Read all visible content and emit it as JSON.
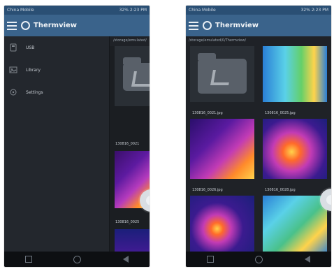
{
  "left": {
    "status": {
      "carrier": "China Mobile",
      "right": "32% 2:23 PM"
    },
    "app_title": "Thermview",
    "path": "/storage/emulated/",
    "menu": [
      {
        "label": "USB",
        "icon": "usb-icon"
      },
      {
        "label": "Library",
        "icon": "library-icon"
      },
      {
        "label": "Settings",
        "icon": "settings-icon"
      }
    ],
    "captions": [
      "130816_0021",
      "130816_0025"
    ]
  },
  "right": {
    "status": {
      "carrier": "China Mobile",
      "right": "32% 2:23 PM"
    },
    "app_title": "Thermview",
    "path": "/storage/emulated/0/Thermview/",
    "items": [
      {
        "label": "130816_0021.jpg"
      },
      {
        "label": "130816_0025.jpg"
      },
      {
        "label": "130816_0026.jpg"
      },
      {
        "label": "130816_0028.jpg"
      }
    ]
  }
}
